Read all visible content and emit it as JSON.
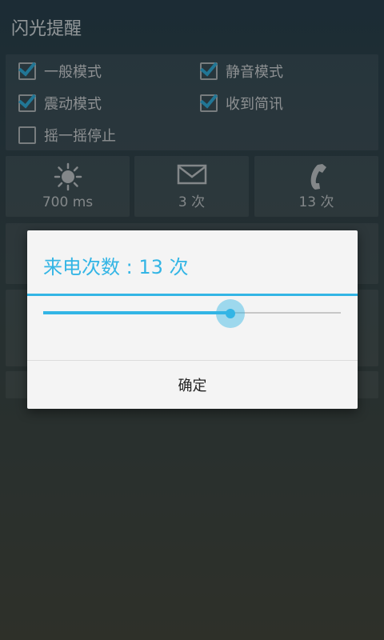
{
  "app": {
    "title": "闪光提醒"
  },
  "modes": [
    {
      "label": "一般模式",
      "checked": true
    },
    {
      "label": "静音模式",
      "checked": true
    },
    {
      "label": "震动模式",
      "checked": true
    },
    {
      "label": "收到简讯",
      "checked": true
    },
    {
      "label": "摇一摇停止",
      "checked": false
    }
  ],
  "tiles": [
    {
      "icon": "sun-icon",
      "value": "700 ms"
    },
    {
      "icon": "envelope-icon",
      "value": "3 次"
    },
    {
      "icon": "phone-icon",
      "value": "13 次"
    }
  ],
  "dialog": {
    "title": "来电次数 : 13 次",
    "slider_fraction": 0.63,
    "ok_label": "确定"
  },
  "colors": {
    "accent": "#33b5e5"
  }
}
